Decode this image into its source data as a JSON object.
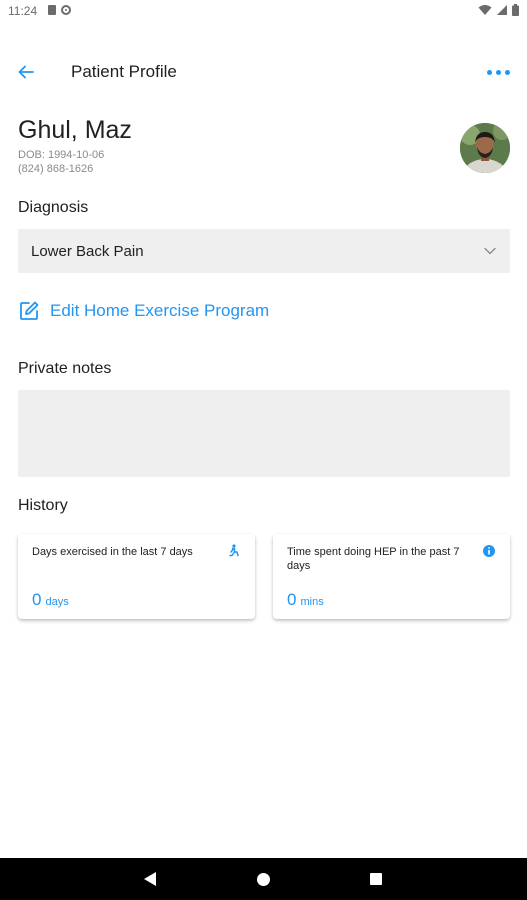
{
  "status_bar": {
    "time": "11:24",
    "icons": [
      "sd-card-icon",
      "at-sign-icon",
      "wifi-icon",
      "signal-icon",
      "battery-icon"
    ]
  },
  "app_bar": {
    "title": "Patient Profile",
    "back_icon": "arrow-left-icon",
    "menu_icon": "more-horizontal-icon"
  },
  "patient": {
    "name": "Ghul, Maz",
    "dob": "DOB: 1994-10-06",
    "phone": "(824) 868-1626"
  },
  "diagnosis": {
    "label": "Diagnosis",
    "selected": "Lower Back Pain"
  },
  "edit_hep": {
    "label": "Edit Home Exercise Program",
    "icon": "edit-icon"
  },
  "notes": {
    "label": "Private notes",
    "value": ""
  },
  "history": {
    "label": "History",
    "cards": [
      {
        "title": "Days exercised in the last 7 days",
        "value": "0",
        "unit": "days",
        "icon": "person-exercise-icon"
      },
      {
        "title": "Time spent doing HEP in the past 7 days",
        "value": "0",
        "unit": "mins",
        "icon": "info-icon"
      }
    ]
  },
  "colors": {
    "accent": "#2196f3",
    "field_background": "#efefef",
    "text_primary": "#212121",
    "text_secondary": "#8a8a8a"
  }
}
